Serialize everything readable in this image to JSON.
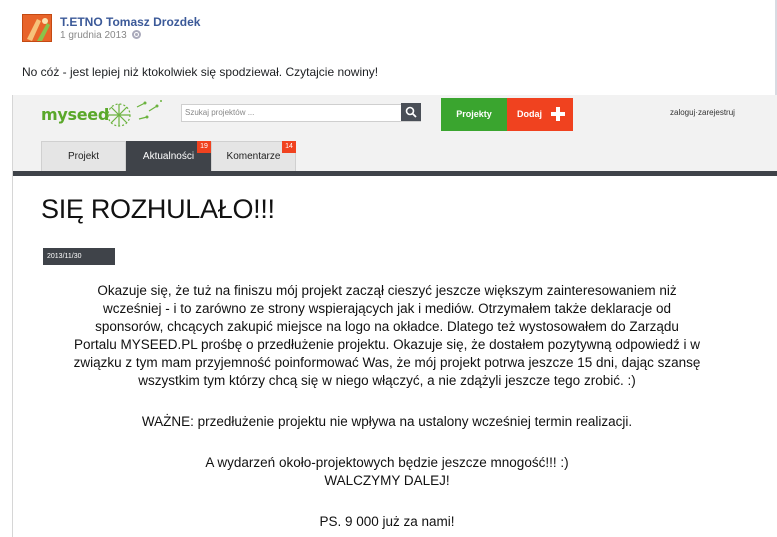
{
  "post": {
    "author": "T.ETNO Tomasz Drozdek",
    "date": "1 grudnia 2013",
    "message": "No cóż - jest lepiej niż ktokolwiek się spodziewał. Czytajcie nowiny!"
  },
  "site": {
    "logo": "myseed",
    "search_placeholder": "Szukaj projektów ...",
    "projects_label": "Projekty",
    "add_label": "Dodaj",
    "login_label": "zaloguj",
    "separator": "·",
    "register_label": "zarejestruj",
    "tabs": [
      {
        "label": "Projekt",
        "badge": ""
      },
      {
        "label": "Aktualności",
        "badge": "19"
      },
      {
        "label": "Komentarze",
        "badge": "14"
      }
    ],
    "colors": {
      "green": "#3aa52f",
      "red": "#f0421f",
      "dark": "#3f4349"
    }
  },
  "article": {
    "title": "SIĘ ROZHULAŁO!!!",
    "date": "2013/11/30",
    "paragraph1_lines": [
      "Okazuje się, że tuż na finiszu mój projekt zaczął cieszyć jeszcze większym zainteresowaniem niż",
      "wcześniej - i to zarówno ze strony wspierających jak i mediów. Otrzymałem także deklaracje od",
      "sponsorów, chcących zakupić miejsce na logo na okładce. Dlatego też wystosowałem do Zarządu",
      "Portalu MYSEED.PL prośbę o przedłużenie projektu. Okazuje się, że dostałem pozytywną odpowiedź i w",
      "związku z tym mam przyjemność poinformować Was, że mój projekt potrwa jeszcze 15 dni, dając szansę",
      "wszystkim tym którzy chcą się w niego włączyć, a nie zdążyli jeszcze tego zrobić. :)"
    ],
    "paragraph2": "WAŻNE: przedłużenie projektu nie wpływa na ustalony wcześniej termin realizacji.",
    "paragraph3_line1": "A wydarzeń około-projektowych będzie jeszcze mnogość!!! :)",
    "paragraph3_line2": "WALCZYMY DALEJ!",
    "paragraph4": "PS.  9 000 już za nami!"
  }
}
